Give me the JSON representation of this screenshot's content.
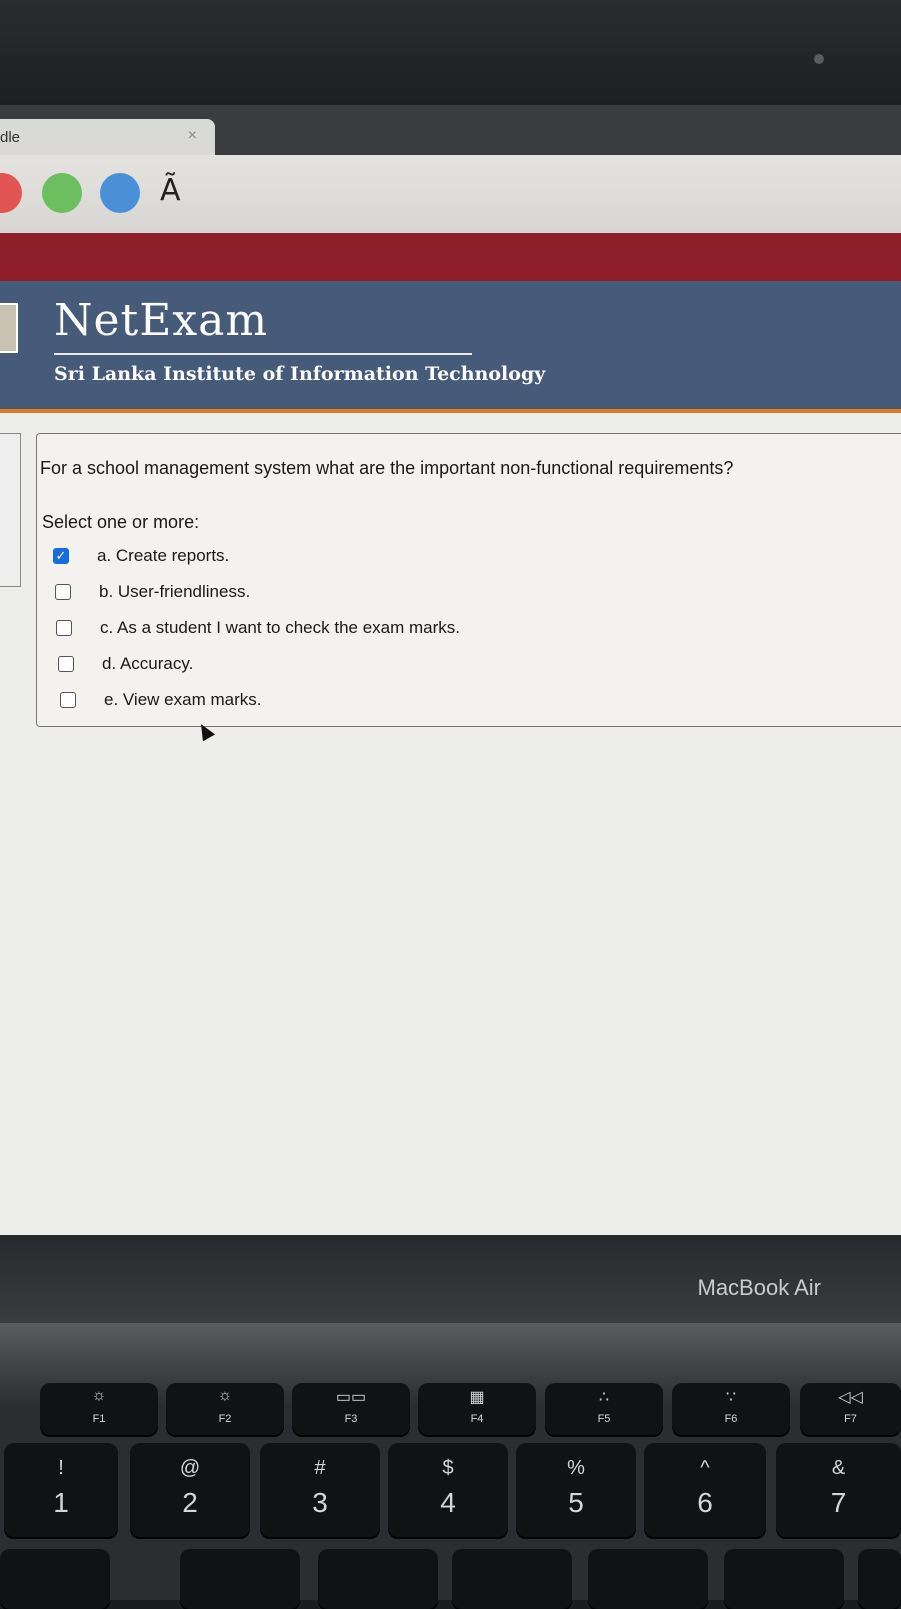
{
  "browser": {
    "tab_title": "dle",
    "tab_close": "×",
    "toolbar_glyph": "Ã"
  },
  "banner": {
    "brand": "NetExam",
    "subtitle": "Sri Lanka Institute of Information Technology"
  },
  "question": {
    "text": "For a school management system what are the important non-functional requirements?",
    "prompt": "Select one or more:",
    "options": [
      {
        "label": "a. Create reports.",
        "checked": true
      },
      {
        "label": "b. User-friendliness.",
        "checked": false
      },
      {
        "label": "c. As a student I want to check the exam marks.",
        "checked": false
      },
      {
        "label": "d. Accuracy.",
        "checked": false
      },
      {
        "label": "e. View exam marks.",
        "checked": false
      }
    ]
  },
  "device": {
    "name": "MacBook Air",
    "fkeys": [
      {
        "glyph": "☼",
        "label": "F1"
      },
      {
        "glyph": "☼",
        "label": "F2"
      },
      {
        "glyph": "▭▭",
        "label": "F3"
      },
      {
        "glyph": "▦",
        "label": "F4"
      },
      {
        "glyph": "∴",
        "label": "F5"
      },
      {
        "glyph": "∵",
        "label": "F6"
      },
      {
        "glyph": "◁◁",
        "label": "F7"
      }
    ],
    "numkeys": [
      {
        "sym": "!",
        "num": "1"
      },
      {
        "sym": "@",
        "num": "2"
      },
      {
        "sym": "#",
        "num": "3"
      },
      {
        "sym": "$",
        "num": "4"
      },
      {
        "sym": "%",
        "num": "5"
      },
      {
        "sym": "^",
        "num": "6"
      },
      {
        "sym": "&",
        "num": "7"
      }
    ]
  }
}
